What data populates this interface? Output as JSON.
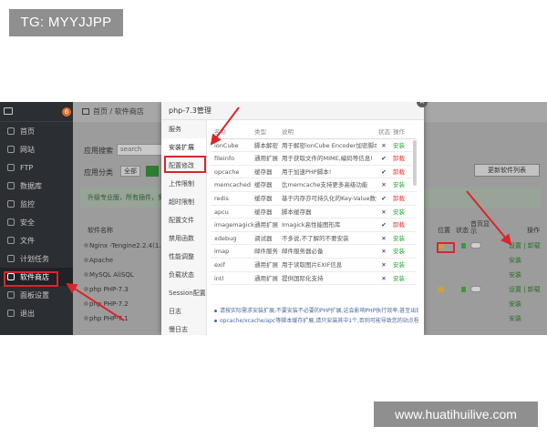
{
  "watermark_top": "TG: MYYJJPP",
  "watermark_bottom": "www.huatihuilive.com",
  "sidebar": {
    "badge": "6",
    "items": [
      {
        "label": "首页"
      },
      {
        "label": "网站"
      },
      {
        "label": "FTP"
      },
      {
        "label": "数据库"
      },
      {
        "label": "监控"
      },
      {
        "label": "安全"
      },
      {
        "label": "文件"
      },
      {
        "label": "计划任务"
      },
      {
        "label": "软件商店"
      },
      {
        "label": "面板设置"
      },
      {
        "label": "退出"
      }
    ],
    "active_index": 8
  },
  "main": {
    "breadcrumb": "首页 / 软件商店",
    "search_label": "应用搜索",
    "search_placeholder": "search",
    "category_label": "应用分类",
    "category_all": "全部",
    "update_button": "更新软件列表",
    "notice": "升级专业版，所有插件，免费使用。",
    "table_headers": {
      "name": "软件名称",
      "location": "位置",
      "state": "状态",
      "home": "首页显示",
      "ops": "操作"
    },
    "rows": [
      {
        "name": "Nginx -Tengine2.2.4(1.1...",
        "ops": "设置 | 卸载"
      },
      {
        "name": "Apache",
        "ops": "安装"
      },
      {
        "name": "MySQL AliSQL",
        "ops": "安装"
      },
      {
        "name": "php PHP-7.3",
        "ops": "设置 | 卸载"
      },
      {
        "name": "php PHP-7.2",
        "ops": "安装"
      },
      {
        "name": "php PHP-7.1",
        "ops": "安装"
      }
    ]
  },
  "dialog": {
    "title": "php-7.3管理",
    "close": "×",
    "nav": [
      {
        "label": "服务"
      },
      {
        "label": "安装扩展"
      },
      {
        "label": "配置修改"
      },
      {
        "label": "上传限制"
      },
      {
        "label": "超时限制"
      },
      {
        "label": "配置文件"
      },
      {
        "label": "禁用函数"
      },
      {
        "label": "性能调整"
      },
      {
        "label": "负载状态"
      },
      {
        "label": "Session配置"
      },
      {
        "label": "日志"
      },
      {
        "label": "慢日志"
      },
      {
        "label": "phpinfo"
      }
    ],
    "active_nav": 1,
    "columns": {
      "name": "名称",
      "type": "类型",
      "desc": "说明",
      "state": "状态",
      "op": "操作"
    },
    "extensions": [
      {
        "name": "ionCube",
        "type": "脚本解密",
        "desc": "用于解密ionCube Encoder加密脚本!",
        "state": "✕",
        "op": "安装",
        "op_kind": "install"
      },
      {
        "name": "fileinfo",
        "type": "通用扩展",
        "desc": "用于获取文件的MIME,编码等信息!",
        "state": "✔",
        "op": "卸载",
        "op_kind": "uninstall"
      },
      {
        "name": "opcache",
        "type": "缓存器",
        "desc": "用于加速PHP脚本!",
        "state": "✔",
        "op": "卸载",
        "op_kind": "uninstall"
      },
      {
        "name": "memcached",
        "type": "缓存器",
        "desc": "比memcache支持更多高级功能",
        "state": "✕",
        "op": "安装",
        "op_kind": "install"
      },
      {
        "name": "redis",
        "type": "缓存器",
        "desc": "基于内存亦可持久化的Key-Value数据库",
        "state": "✔",
        "op": "卸载",
        "op_kind": "uninstall"
      },
      {
        "name": "apcu",
        "type": "缓存器",
        "desc": "脚本缓存器",
        "state": "✕",
        "op": "安装",
        "op_kind": "install"
      },
      {
        "name": "imagemagick",
        "type": "通用扩展",
        "desc": "Imagick高性能图形库",
        "state": "✔",
        "op": "卸载",
        "op_kind": "uninstall"
      },
      {
        "name": "xdebug",
        "type": "调试器",
        "desc": "不多说,不了解的不要安装",
        "state": "✕",
        "op": "安装",
        "op_kind": "install"
      },
      {
        "name": "imap",
        "type": "邮件服务",
        "desc": "邮件服务器必备",
        "state": "✕",
        "op": "安装",
        "op_kind": "install"
      },
      {
        "name": "exif",
        "type": "通用扩展",
        "desc": "用于读取图片EXIF信息",
        "state": "✕",
        "op": "安装",
        "op_kind": "install"
      },
      {
        "name": "intl",
        "type": "通用扩展",
        "desc": "提供国际化支持",
        "state": "✕",
        "op": "安装",
        "op_kind": "install"
      }
    ],
    "notes": [
      "请按实际需求安装扩展,不要安装不必要的PHP扩展,这会影响PHP执行效率,甚至出现异常",
      "opcache/xcache/apc等脚本缓存扩展,请只安装其中1个,否则可能导致您的站点程序异常"
    ]
  },
  "colors": {
    "highlight_red": "#d9262c",
    "install_green": "#20a53a",
    "uninstall_red": "#e0312d",
    "sidebar_bg": "#2b2e33"
  }
}
